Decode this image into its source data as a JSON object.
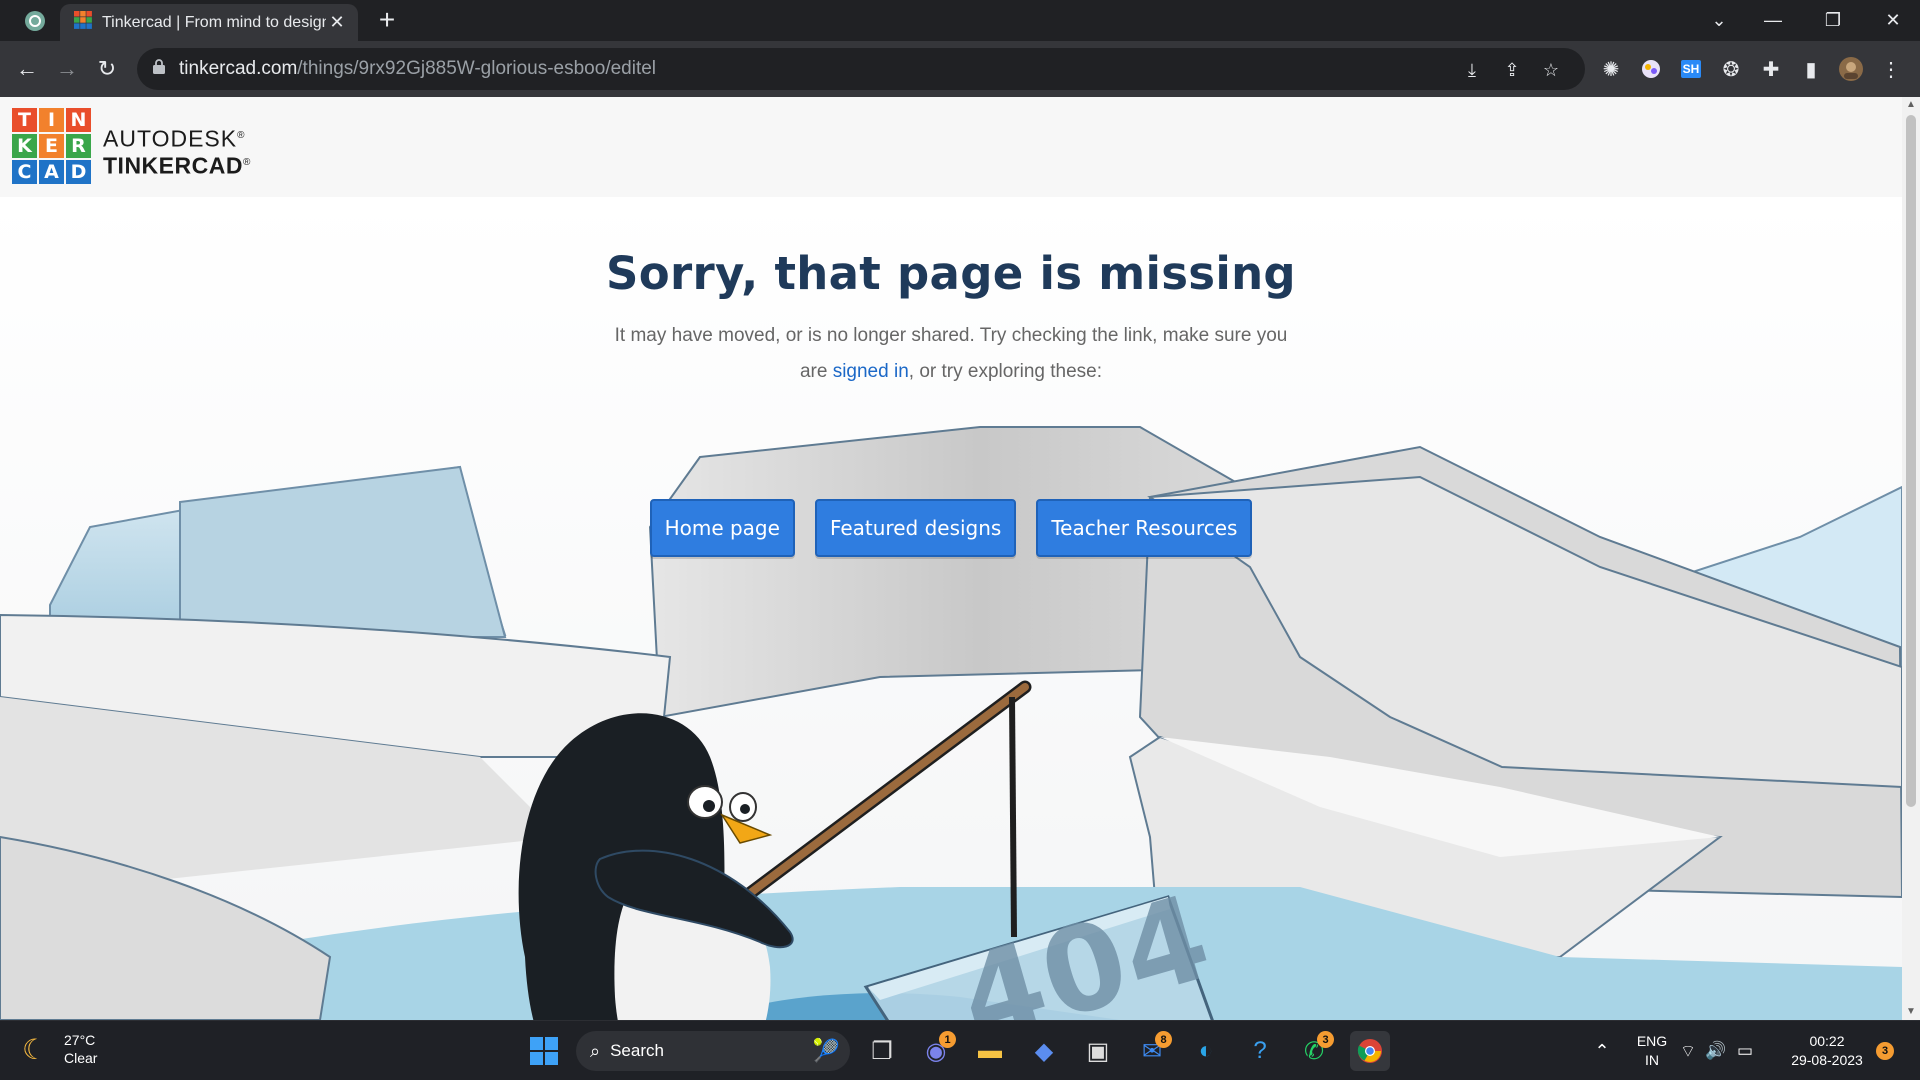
{
  "browser": {
    "tab_title": "Tinkercad | From mind to design",
    "url_host": "tinkercad.com",
    "url_path": "/things/9rx92Gj885W-glorious-esboo/editel"
  },
  "site": {
    "logo_letters": [
      "T",
      "I",
      "N",
      "K",
      "E",
      "R",
      "C",
      "A",
      "D"
    ],
    "logo_colors": [
      "#e94e2b",
      "#f2812c",
      "#e94e2b",
      "#3aa64a",
      "#f2812c",
      "#3aa64a",
      "#1f73c7",
      "#1f73c7",
      "#1f73c7"
    ],
    "brand_line1": "AUTODESK",
    "brand_line2": "TINKERCAD",
    "registered_mark": "®"
  },
  "error": {
    "heading": "Sorry, that page is missing",
    "message_part1": "It may have moved, or is no longer shared. Try checking the link, make sure you are",
    "signin_link": "signed in",
    "message_part2": ", or try exploring these:",
    "buttons": [
      "Home page",
      "Featured designs",
      "Teacher Resources"
    ],
    "illustration_code": "404"
  },
  "taskbar": {
    "weather_temp": "27°C",
    "weather_desc": "Clear",
    "search_label": "Search",
    "lang_line1": "ENG",
    "lang_line2": "IN",
    "time": "00:22",
    "date": "29-08-2023",
    "badges": {
      "teams": "1",
      "mail": "8",
      "whatsapp": "3",
      "notifications": "3"
    }
  },
  "colors": {
    "accent_button": "#2f7de0",
    "heading": "#1f3a5a",
    "link": "#1b68c7"
  }
}
